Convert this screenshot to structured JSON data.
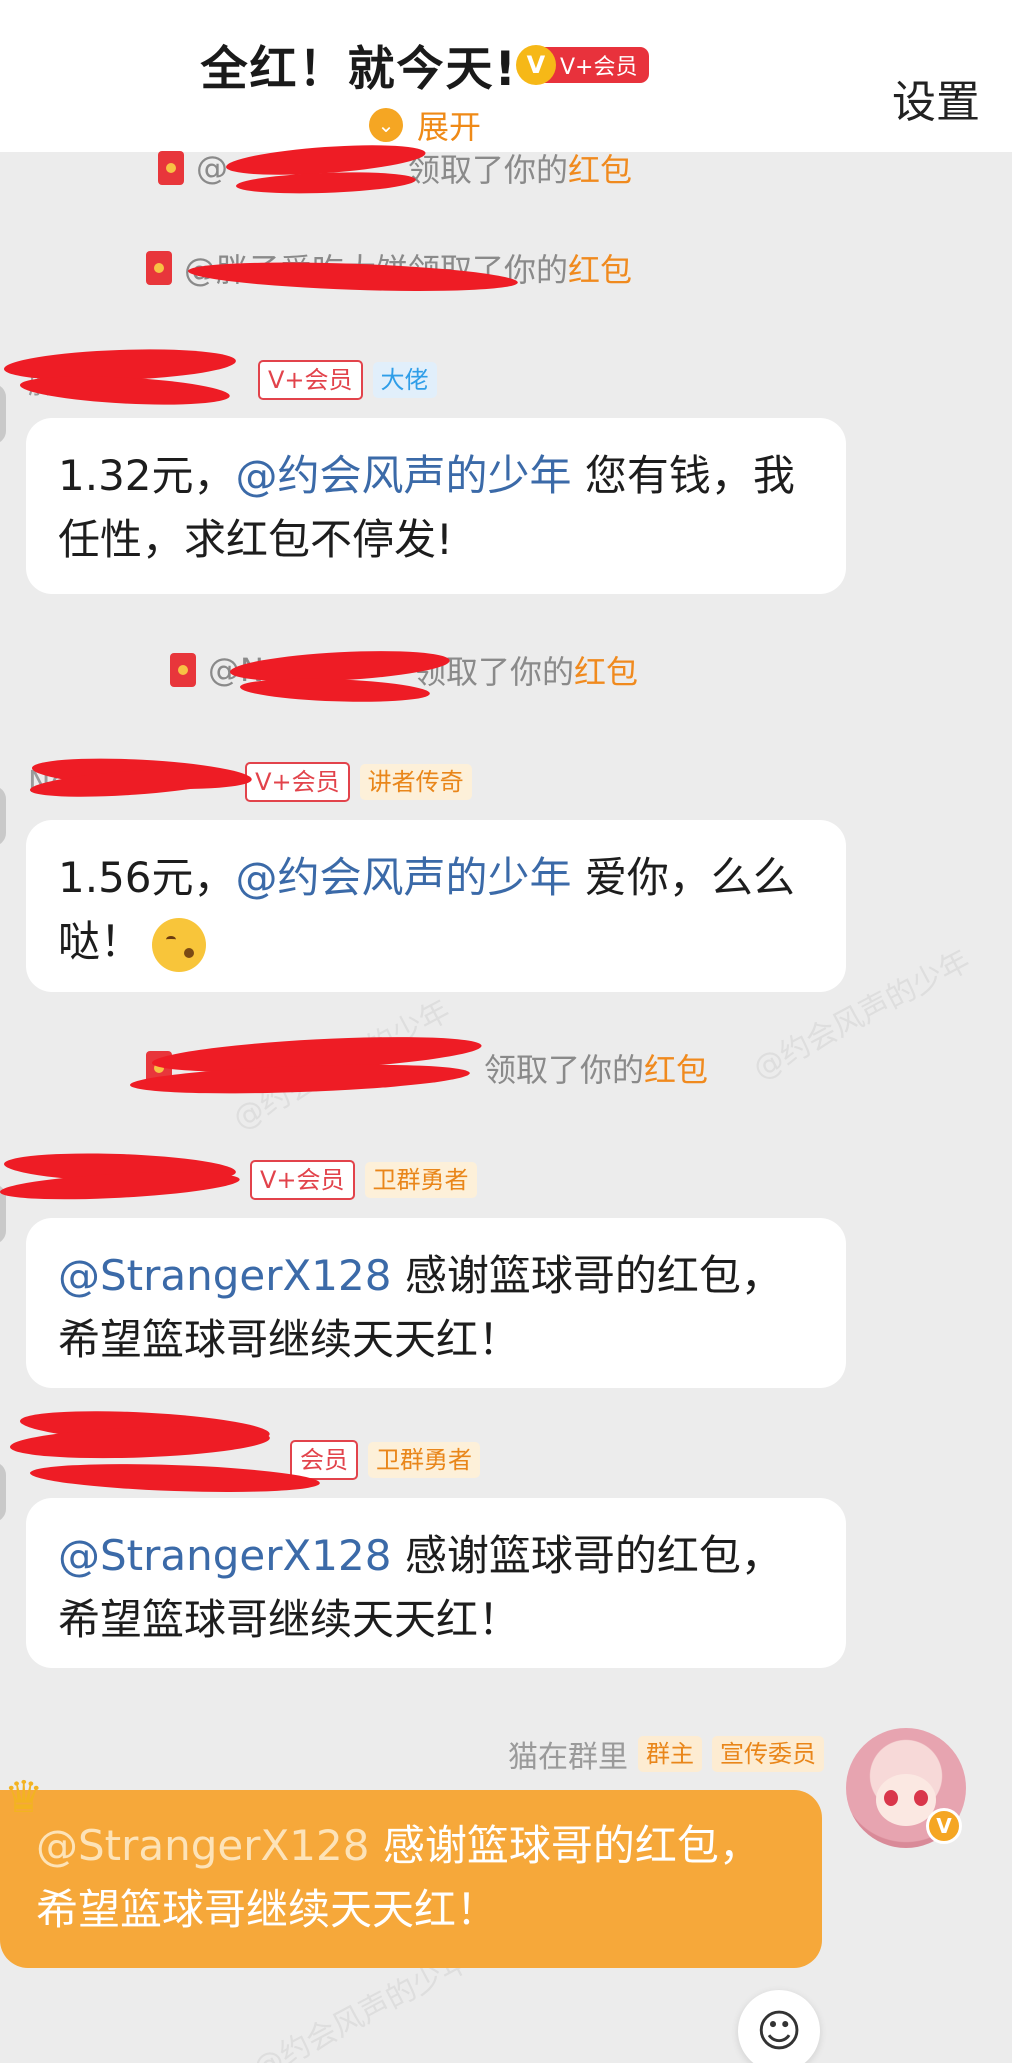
{
  "header": {
    "title": "全红！就今天!",
    "vip_badge_label": "V+会员",
    "vip_badge_letter": "V",
    "expand_label": "展开",
    "settings_label": "设置"
  },
  "notices": [
    {
      "user": "@",
      "action": "领取了你的",
      "highlight": "红包"
    },
    {
      "user": "@胖子爱吃大饼",
      "action": "领取了你的",
      "highlight": "红包"
    },
    {
      "user": "@N",
      "action": "领取了你的",
      "highlight": "红包"
    },
    {
      "user": "",
      "action": "领取了你的",
      "highlight": "红包"
    }
  ],
  "messages": [
    {
      "sender": "胖",
      "tags": [
        "V+会员",
        "大佬"
      ],
      "amount": "1.32元，",
      "mention": "@约会风声的少年",
      "text": " 您有钱，我任性，求红包不停发!"
    },
    {
      "sender": "Neve",
      "tags": [
        "V+会员",
        "讲者传奇"
      ],
      "amount": "1.56元，",
      "mention": "@约会风声的少年",
      "text": " 爱你，么么哒！"
    },
    {
      "sender": "",
      "tags": [
        "V+会员",
        "卫群勇者"
      ],
      "mention": "@StrangerX128",
      "text": " 感谢篮球哥的红包，希望篮球哥继续天天红！"
    },
    {
      "sender": "",
      "tags": [
        "会员",
        "卫群勇者"
      ],
      "mention": "@StrangerX128",
      "text": " 感谢篮球哥的红包，希望篮球哥继续天天红！"
    }
  ],
  "own_message": {
    "sender": "猫在群里",
    "tags": [
      "群主",
      "宣传委员"
    ],
    "mention": "@StrangerX128",
    "text": " 感谢篮球哥的红包，希望篮球哥继续天天红！",
    "verify_letter": "V"
  },
  "watermark": "@约会风声的少年",
  "icons": {
    "expand": "chevron-down-circle-icon",
    "envelope": "red-envelope-icon",
    "crown": "crown-icon",
    "emoji": "smiley-plus-icon"
  },
  "colors": {
    "accent_orange": "#f6a83a",
    "link_blue": "#3b6aa8",
    "redaction": "#ee1c25"
  }
}
